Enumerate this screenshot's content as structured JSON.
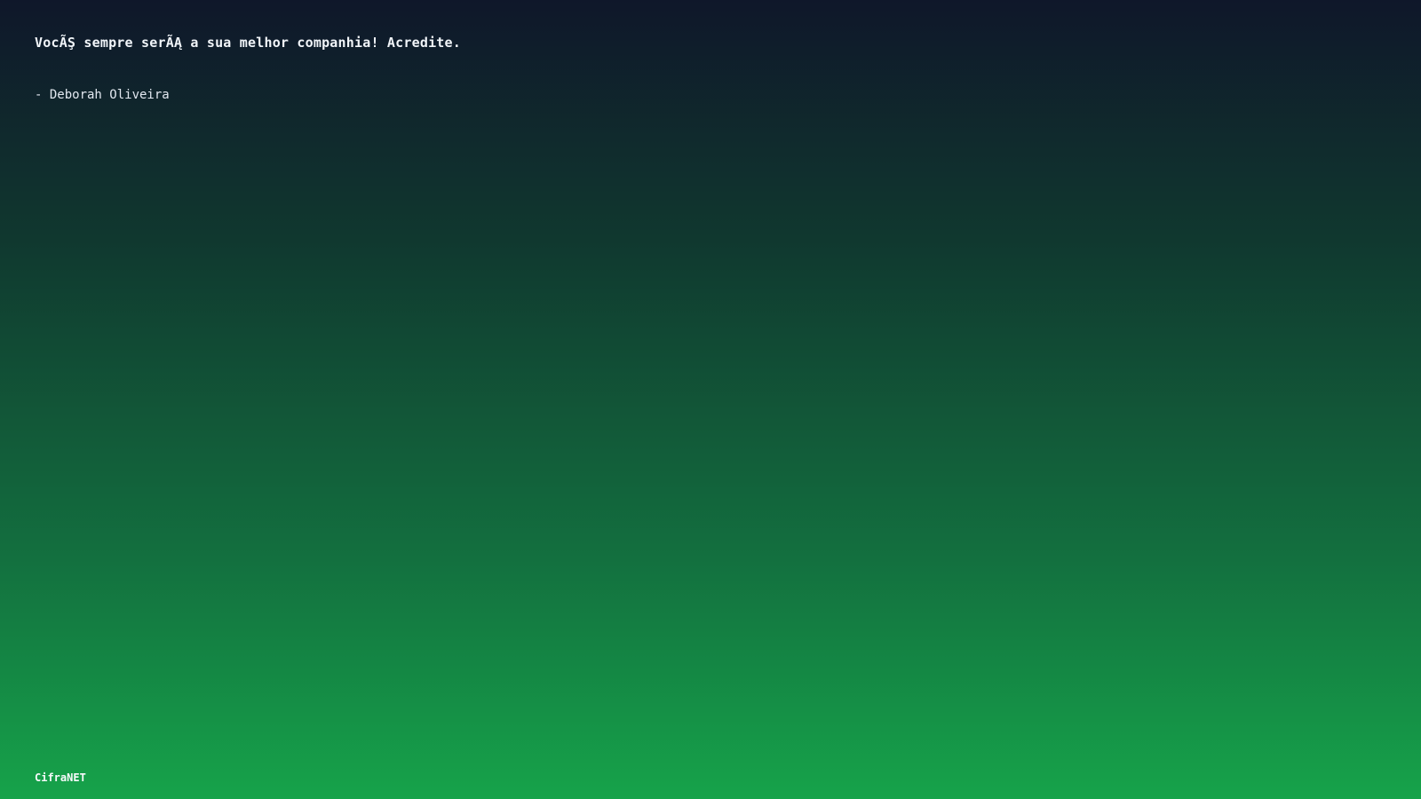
{
  "quote": {
    "text": "VocÃŞ sempre serÃĄ a sua melhor companhia! Acredite.",
    "author": "- Deborah Oliveira"
  },
  "brand": {
    "name": "CifraNET"
  },
  "colors": {
    "gradient_top": "#0f172a",
    "gradient_bottom": "#16a34a",
    "text": "#f1f5f9"
  }
}
